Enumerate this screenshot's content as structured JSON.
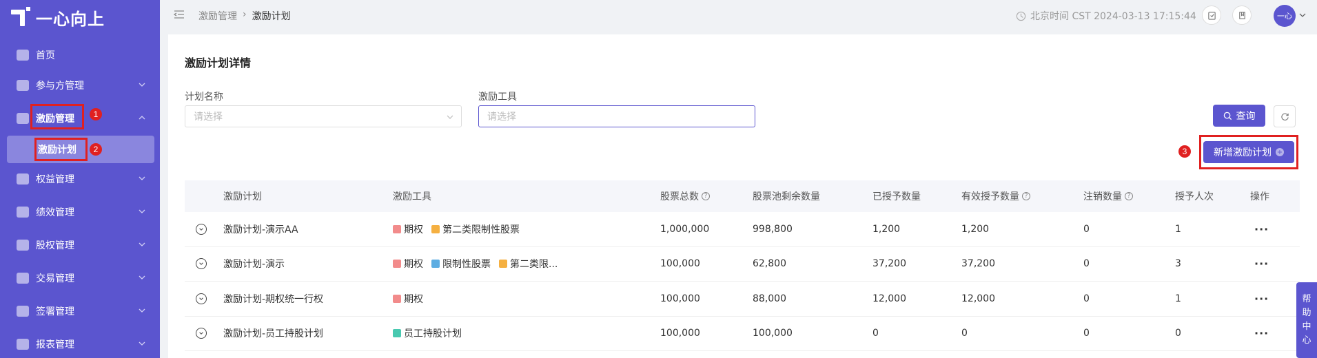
{
  "brand": {
    "name": "一心向上"
  },
  "sidebar": {
    "items": [
      {
        "label": "首页",
        "icon": "home-icon"
      },
      {
        "label": "参与方管理",
        "icon": "users-icon"
      },
      {
        "label": "激励管理",
        "icon": "gift-icon"
      },
      {
        "label": "权益管理",
        "icon": "equity-icon"
      },
      {
        "label": "绩效管理",
        "icon": "performance-icon"
      },
      {
        "label": "股权管理",
        "icon": "shares-icon"
      },
      {
        "label": "交易管理",
        "icon": "trade-icon"
      },
      {
        "label": "签署管理",
        "icon": "sign-icon"
      },
      {
        "label": "报表管理",
        "icon": "report-icon"
      }
    ],
    "sub_item": {
      "label": "激励计划"
    }
  },
  "annotations": {
    "n1": "1",
    "n2": "2",
    "n3": "3"
  },
  "header": {
    "breadcrumb": [
      "激励管理",
      "激励计划"
    ],
    "clock": "北京时间 CST 2024-03-13 17:15:44",
    "avatar": "一心"
  },
  "page": {
    "title": "激励计划详情",
    "filters": {
      "plan_name_label": "计划名称",
      "plan_name_placeholder": "请选择",
      "tool_label": "激励工具",
      "tool_placeholder": "请选择"
    },
    "query_button": "查询",
    "add_button": "新增激励计划"
  },
  "table": {
    "headers": [
      "激励计划",
      "激励工具",
      "股票总数",
      "股票池剩余数量",
      "已授予数量",
      "有效授予数量",
      "注销数量",
      "授予人次",
      "操作"
    ],
    "rows": [
      {
        "plan": "激励计划-演示AA",
        "tools": [
          {
            "label": "期权",
            "color": "#f28b8b"
          },
          {
            "label": "第二类限制性股票",
            "color": "#f5b041"
          }
        ],
        "total": "1,000,000",
        "pool": "998,800",
        "granted": "1,200",
        "valid": "1,200",
        "cancelled": "0",
        "count": "1"
      },
      {
        "plan": "激励计划-演示",
        "tools": [
          {
            "label": "期权",
            "color": "#f28b8b"
          },
          {
            "label": "限制性股票",
            "color": "#5dade2"
          },
          {
            "label": "第二类限...",
            "color": "#f5b041"
          }
        ],
        "total": "100,000",
        "pool": "62,800",
        "granted": "37,200",
        "valid": "37,200",
        "cancelled": "0",
        "count": "3"
      },
      {
        "plan": "激励计划-期权统一行权",
        "tools": [
          {
            "label": "期权",
            "color": "#f28b8b"
          }
        ],
        "total": "100,000",
        "pool": "88,000",
        "granted": "12,000",
        "valid": "12,000",
        "cancelled": "0",
        "count": "1"
      },
      {
        "plan": "激励计划-员工持股计划",
        "tools": [
          {
            "label": "员工持股计划",
            "color": "#48c9b0"
          }
        ],
        "total": "100,000",
        "pool": "100,000",
        "granted": "0",
        "valid": "0",
        "cancelled": "0",
        "count": "0"
      }
    ],
    "actions_label": "···"
  },
  "help": {
    "chars": [
      "帮",
      "助",
      "中",
      "心"
    ]
  }
}
